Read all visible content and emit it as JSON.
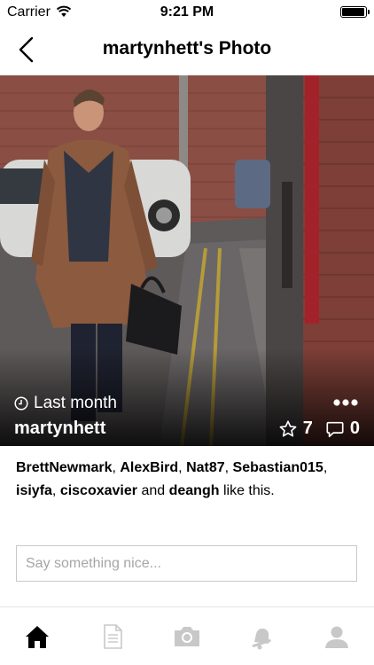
{
  "status_bar": {
    "carrier": "Carrier",
    "time": "9:21 PM",
    "battery_level": 0.95
  },
  "navbar": {
    "title": "martynhett's Photo",
    "back_icon": "chevron-left-icon"
  },
  "photo": {
    "timestamp": "Last month",
    "username": "martynhett",
    "stars_count": "7",
    "comments_count": "0",
    "more_icon": "more-dots-icon"
  },
  "likes": {
    "users": [
      "BrettNewmark",
      "AlexBird",
      "Nat87",
      "Sebastian015",
      "isiyfa",
      "ciscoxavier"
    ],
    "connector": "and",
    "last_user": "deangh",
    "suffix": "like this."
  },
  "comment_input": {
    "placeholder": "Say something nice...",
    "value": ""
  },
  "tabbar": {
    "tabs": [
      {
        "icon": "home-icon",
        "active": true
      },
      {
        "icon": "document-icon",
        "active": false
      },
      {
        "icon": "camera-icon",
        "active": false
      },
      {
        "icon": "bell-icon",
        "active": false
      },
      {
        "icon": "profile-icon",
        "active": false
      }
    ],
    "active_color": "#000000",
    "inactive_color": "#c8c8c8"
  }
}
